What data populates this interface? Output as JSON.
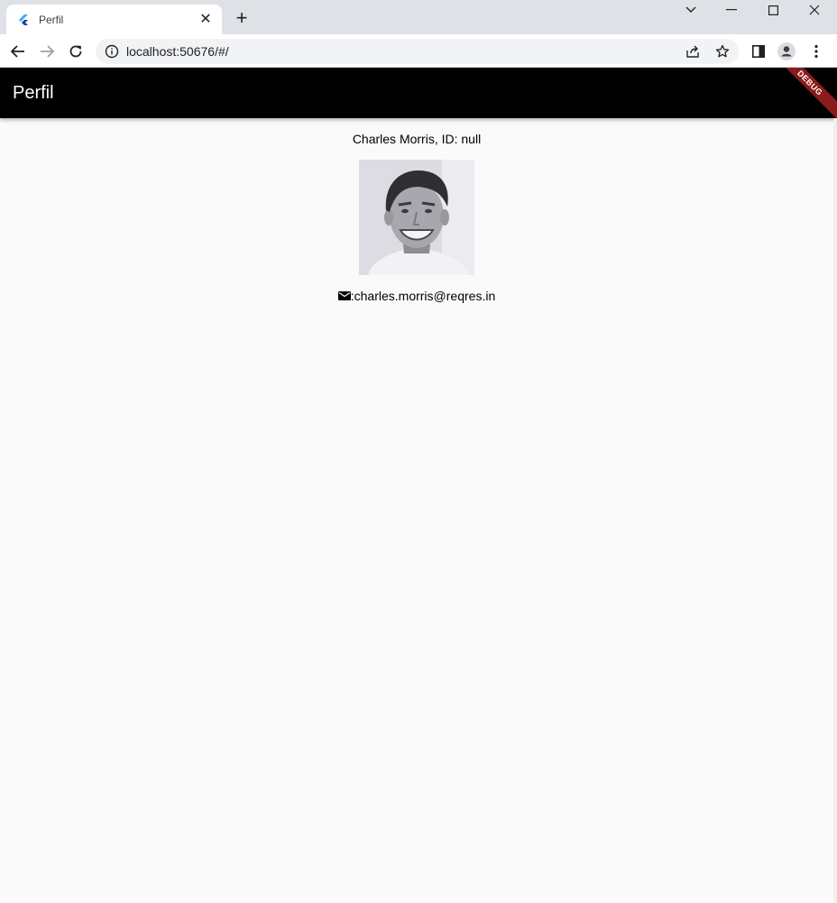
{
  "browser": {
    "tab_title": "Perfil",
    "tab_close": "✕",
    "new_tab": "+",
    "url": "localhost:50676/#/"
  },
  "app": {
    "title": "Perfil",
    "debug_banner": "DEBUG"
  },
  "profile": {
    "name_line": "Charles Morris, ID: null",
    "email_line": ":charles.morris@reqres.in"
  }
}
